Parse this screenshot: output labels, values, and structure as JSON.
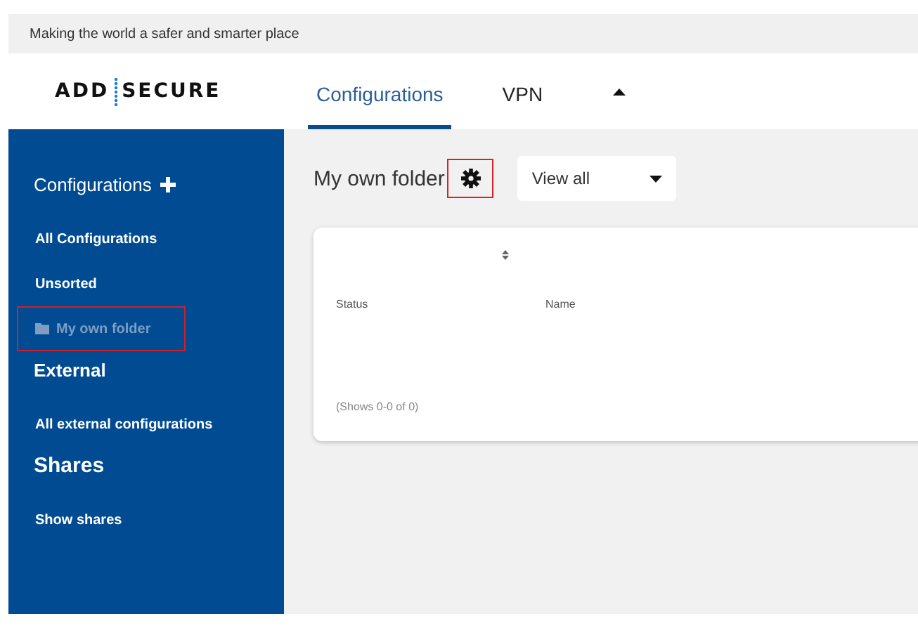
{
  "top_bar": {
    "tagline": "Making the world a safer and smarter place"
  },
  "header": {
    "logo": {
      "left": "ADD",
      "right": "SECURE"
    },
    "tabs": [
      {
        "label": "Configurations",
        "selected": true
      },
      {
        "label": "VPN",
        "selected": false
      }
    ]
  },
  "sidebar": {
    "sections": [
      {
        "title": "Configurations",
        "kind": "add",
        "items": [
          {
            "label": "All Configurations",
            "selected": false,
            "folder": false,
            "highlighted": false
          },
          {
            "label": "Unsorted",
            "selected": false,
            "folder": false,
            "highlighted": false
          },
          {
            "label": "My own folder",
            "selected": true,
            "folder": true,
            "highlighted": true
          }
        ]
      },
      {
        "title": "External",
        "kind": "plain",
        "items": [
          {
            "label": "All external configurations",
            "selected": false,
            "folder": false,
            "highlighted": false
          }
        ]
      },
      {
        "title": "Shares",
        "kind": "large",
        "items": [
          {
            "label": "Show shares",
            "selected": false,
            "folder": false,
            "highlighted": false
          }
        ]
      }
    ]
  },
  "main": {
    "title": "My own folder",
    "settings_highlighted": true,
    "view_select": {
      "value": "View all"
    },
    "table": {
      "columns": [
        {
          "label": "Status"
        },
        {
          "label": "Name"
        }
      ],
      "footer": "(Shows 0-0 of 0)"
    }
  }
}
